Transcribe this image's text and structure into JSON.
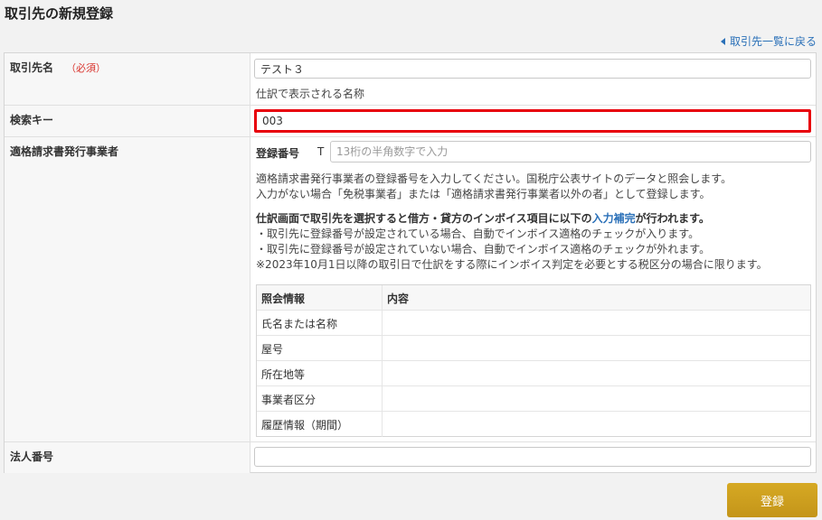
{
  "page": {
    "title": "取引先の新規登録",
    "back_link": "取引先一覧に戻る"
  },
  "fields": {
    "name": {
      "label": "取引先名",
      "required": "（必須）",
      "value": "テスト３",
      "hint": "仕訳で表示される名称"
    },
    "search_key": {
      "label": "検索キー",
      "value": "003"
    },
    "invoice": {
      "label": "適格請求書発行事業者",
      "reg_label": "登録番号",
      "reg_prefix": "T",
      "reg_placeholder": "13桁の半角数字で入力",
      "desc1": "適格請求書発行事業者の登録番号を入力してください。国税庁公表サイトのデータと照会します。",
      "desc2": "入力がない場合「免税事業者」または「適格請求書発行事業者以外の者」として登録します。",
      "bold_pre": "仕訳画面で取引先を選択すると借方・貸方のインボイス項目に以下の",
      "bold_link": "入力補完",
      "bold_post": "が行われます。",
      "bullet1": "・取引先に登録番号が設定されている場合、自動でインボイス適格のチェックが入ります。",
      "bullet2": "・取引先に登録番号が設定されていない場合、自動でインボイス適格のチェックが外れます。",
      "note": "※2023年10月1日以降の取引日で仕訳をする際にインボイス判定を必要とする税区分の場合に限ります。",
      "ref_table": {
        "headers": [
          "照会情報",
          "内容"
        ],
        "rows": [
          "氏名または名称",
          "屋号",
          "所在地等",
          "事業者区分",
          "履歴情報（期間）"
        ]
      }
    },
    "corp_number": {
      "label": "法人番号",
      "value": ""
    }
  },
  "submit_label": "登録"
}
